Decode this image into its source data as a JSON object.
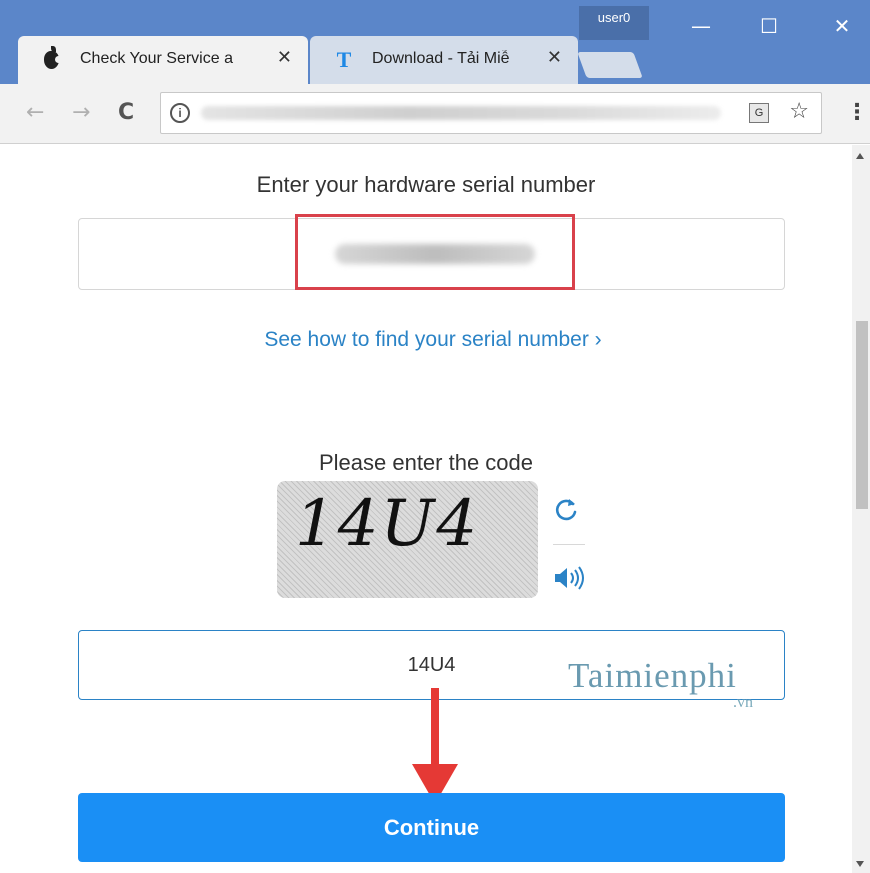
{
  "browser": {
    "profile_name": "user0",
    "window_controls": {
      "minimize": "—",
      "maximize": "☐",
      "close": "✕"
    },
    "tabs": [
      {
        "title": "Check Your Service a",
        "icon": "apple-icon",
        "active": true,
        "close": "✕"
      },
      {
        "title": "Download - Tải Miễ",
        "icon": "t-logo-icon",
        "icon_glyph": "T",
        "active": false,
        "close": "✕"
      }
    ],
    "toolbar": {
      "back": "←",
      "forward": "→",
      "reload": "C",
      "info": "i",
      "translate": "G",
      "star": "☆",
      "menu": "⋮"
    }
  },
  "page": {
    "serial_label": "Enter your hardware serial number",
    "find_serial_link": "See how to find your serial number ›",
    "code_label": "Please enter the code",
    "captcha_text": "14U4",
    "code_input_value": "14U4",
    "continue_button": "Continue"
  },
  "watermark": {
    "text": "Taimienphi",
    "suffix": ".vn"
  },
  "colors": {
    "titlebar": "#5b86c9",
    "link": "#2b83c6",
    "button": "#1a8ff5",
    "highlight": "#d9414b",
    "arrow": "#e53935"
  }
}
